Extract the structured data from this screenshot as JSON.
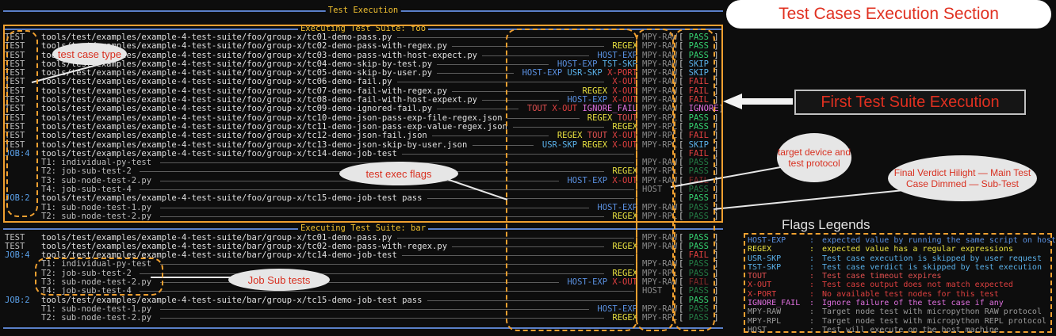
{
  "header_title": "Test Execution",
  "suites": [
    {
      "title": "Executing Test Suite: foo",
      "rows": [
        {
          "kind": "TEST",
          "path": "tools/test/examples/example-4-test-suite/foo/group-x/tc01-demo-pass.py",
          "flags": [],
          "target": "MPY-RAW",
          "verdict": "PASS"
        },
        {
          "kind": "TEST",
          "path": "tools/test/examples/example-4-test-suite/foo/group-x/tc02-demo-pass-with-regex.py",
          "flags": [
            "REGEX"
          ],
          "target": "MPY-RAW",
          "verdict": "PASS"
        },
        {
          "kind": "TEST",
          "path": "tools/test/examples/example-4-test-suite/foo/group-x/tc03-demo-pass-with-host-expect.py",
          "flags": [
            "HOST-EXP"
          ],
          "target": "MPY-RAW",
          "verdict": "PASS"
        },
        {
          "kind": "TEST",
          "path": "tools/test/examples/example-4-test-suite/foo/group-x/tc04-demo-skip-by-test.py",
          "flags": [
            "HOST-EXP",
            "TST-SKP"
          ],
          "target": "MPY-RAW",
          "verdict": "SKIP"
        },
        {
          "kind": "TEST",
          "path": "tools/test/examples/example-4-test-suite/foo/group-x/tc05-demo-skip-by-user.py",
          "flags": [
            "HOST-EXP",
            "USR-SKP",
            "X-PORT"
          ],
          "target": "MPY-RAW",
          "verdict": "SKIP"
        },
        {
          "kind": "TEST",
          "path": "tools/test/examples/example-4-test-suite/foo/group-x/tc06-demo-fail.py",
          "flags": [
            "X-OUT"
          ],
          "target": "MPY-RAW",
          "verdict": "FAIL"
        },
        {
          "kind": "TEST",
          "path": "tools/test/examples/example-4-test-suite/foo/group-x/tc07-demo-fail-with-regex.py",
          "flags": [
            "REGEX",
            "X-OUT"
          ],
          "target": "MPY-RAW",
          "verdict": "FAIL"
        },
        {
          "kind": "TEST",
          "path": "tools/test/examples/example-4-test-suite/foo/group-x/tc08-demo-fail-with-host-expext.py",
          "flags": [
            "HOST-EXP",
            "X-OUT"
          ],
          "target": "MPY-RAW",
          "verdict": "FAIL"
        },
        {
          "kind": "TEST",
          "path": "tools/test/examples/example-4-test-suite/foo/group-x/tc09-demo-ignored-fail.py",
          "flags": [
            "TOUT",
            "X-OUT",
            "IGNORE_FAIL"
          ],
          "target": "MPY-RAW",
          "verdict": "IGNORE"
        },
        {
          "kind": "TEST",
          "path": "tools/test/examples/example-4-test-suite/foo/group-x/tc10-demo-json-pass-exp-file-regex.json",
          "flags": [
            "REGEX",
            "TOUT"
          ],
          "target": "MPY-RPL",
          "verdict": "PASS"
        },
        {
          "kind": "TEST",
          "path": "tools/test/examples/example-4-test-suite/foo/group-x/tc11-demo-json-pass-exp-value-regex.json",
          "flags": [
            "REGEX"
          ],
          "target": "MPY-RPL",
          "verdict": "PASS"
        },
        {
          "kind": "TEST",
          "path": "tools/test/examples/example-4-test-suite/foo/group-x/tc12-demo-json-fail.json",
          "flags": [
            "REGEX",
            "TOUT",
            "X-OUT"
          ],
          "target": "MPY-RPL",
          "verdict": "FAIL"
        },
        {
          "kind": "TEST",
          "path": "tools/test/examples/example-4-test-suite/foo/group-x/tc13-demo-json-skip-by-user.json",
          "flags": [
            "USR-SKP",
            "REGEX",
            "X-OUT"
          ],
          "target": "MPY-RPL",
          "verdict": "SKIP"
        },
        {
          "kind": "JOB:4",
          "path": "tools/test/examples/example-4-test-suite/foo/group-x/tc14-demo-job-test",
          "flags": [],
          "target": "",
          "verdict": "FAIL"
        },
        {
          "kind": "",
          "sub": true,
          "path": "T1: individual-py-test",
          "flags": [],
          "target": "MPY-RAW",
          "verdict": "PASS"
        },
        {
          "kind": "",
          "sub": true,
          "path": "T2: job-sub-test-2",
          "flags": [
            "REGEX"
          ],
          "target": "MPY-RPL",
          "verdict": "PASS"
        },
        {
          "kind": "",
          "sub": true,
          "path": "T3: sub-node-test-2.py",
          "flags": [
            "HOST-EXP",
            "X-OUT"
          ],
          "target": "MPY-RAW",
          "verdict": "FAIL"
        },
        {
          "kind": "",
          "sub": true,
          "path": "T4: job-sub-test-4",
          "flags": [],
          "target": "HOST",
          "verdict": "PASS"
        },
        {
          "kind": "JOB:2",
          "path": "tools/test/examples/example-4-test-suite/foo/group-x/tc15-demo-job-test pass",
          "flags": [],
          "target": "",
          "verdict": "PASS"
        },
        {
          "kind": "",
          "sub": true,
          "path": "T1: sub-node-test-1.py",
          "flags": [
            "HOST-EXP"
          ],
          "target": "MPY-RAW",
          "verdict": "PASS"
        },
        {
          "kind": "",
          "sub": true,
          "path": "T2: sub-node-test-2.py",
          "flags": [
            "REGEX"
          ],
          "target": "MPY-RPL",
          "verdict": "PASS"
        }
      ]
    },
    {
      "title": "Executing Test Suite: bar",
      "rows": [
        {
          "kind": "TEST",
          "path": "tools/test/examples/example-4-test-suite/bar/group-x/tc01-demo-pass.py",
          "flags": [],
          "target": "MPY-RAW",
          "verdict": "PASS"
        },
        {
          "kind": "TEST",
          "path": "tools/test/examples/example-4-test-suite/bar/group-x/tc02-demo-pass-with-regex.py",
          "flags": [
            "REGEX"
          ],
          "target": "MPY-RAW",
          "verdict": "PASS"
        },
        {
          "kind": "JOB:4",
          "path": "tools/test/examples/example-4-test-suite/bar/group-x/tc14-demo-job-test",
          "flags": [],
          "target": "",
          "verdict": "FAIL"
        },
        {
          "kind": "",
          "sub": true,
          "path": "T1: individual-py-test",
          "flags": [],
          "target": "MPY-RAW",
          "verdict": "PASS"
        },
        {
          "kind": "",
          "sub": true,
          "path": "T2: job-sub-test-2",
          "flags": [
            "REGEX"
          ],
          "target": "MPY-RPL",
          "verdict": "PASS"
        },
        {
          "kind": "",
          "sub": true,
          "path": "T3: sub-node-test-2.py",
          "flags": [
            "HOST-EXP",
            "X-OUT"
          ],
          "target": "MPY-RAW",
          "verdict": "FAIL"
        },
        {
          "kind": "",
          "sub": true,
          "path": "T4: job-sub-test-4",
          "flags": [],
          "target": "HOST",
          "verdict": "PASS"
        },
        {
          "kind": "JOB:2",
          "path": "tools/test/examples/example-4-test-suite/bar/group-x/tc15-demo-job-test pass",
          "flags": [],
          "target": "",
          "verdict": "PASS"
        },
        {
          "kind": "",
          "sub": true,
          "path": "T1: sub-node-test-1.py",
          "flags": [
            "HOST-EXP"
          ],
          "target": "MPY-RAW",
          "verdict": "PASS"
        },
        {
          "kind": "",
          "sub": true,
          "path": "T2: sub-node-test-2.py",
          "flags": [
            "REGEX"
          ],
          "target": "MPY-RPL",
          "verdict": "PASS"
        }
      ]
    }
  ],
  "annotations": {
    "section_title": "Test Cases Execution Section",
    "first_suite": "First Test Suite Execution",
    "test_case_type": "test case type",
    "exec_flags": "test exec flags",
    "target_protocol": "target device and test protocol",
    "final_verdict": "Final Verdict Hilight — Main Test Case Dimmed — Sub-Test",
    "job_sub_tests": "Job Sub tests",
    "legend_title": "Flags Legends"
  },
  "legend": [
    {
      "key": "HOST-EXP",
      "desc": "expected value by running the same script on host",
      "color": "#5a90e0"
    },
    {
      "key": "REGEX",
      "desc": "expected value has a regular expressions",
      "color": "#e8e040"
    },
    {
      "key": "USR-SKP",
      "desc": "Test case execution is skipped by user request",
      "color": "#5ab0e8"
    },
    {
      "key": "TST-SKP",
      "desc": "Test case verdict is skipped by test execution",
      "color": "#5ab0e8"
    },
    {
      "key": "TOUT",
      "desc": "Test case timeout expires",
      "color": "#e05050"
    },
    {
      "key": "X-OUT",
      "desc": "Test case output does not match expected",
      "color": "#e04040"
    },
    {
      "key": "X-PORT",
      "desc": "No available test nodes for this test",
      "color": "#e04040"
    },
    {
      "key": "IGNORE_FAIL",
      "desc": "Ignore failure of the test case if any",
      "color": "#e070e0"
    },
    {
      "key": "MPY-RAW",
      "desc": "Target node test with micropython RAW protocol",
      "color": "#9a9a9a"
    },
    {
      "key": "MPY-RPL",
      "desc": "Target node test with micropython REPL protocol",
      "color": "#9a9a9a"
    },
    {
      "key": "HOST",
      "desc": "Test will execute on the host machine",
      "color": "#9a9a9a"
    }
  ]
}
